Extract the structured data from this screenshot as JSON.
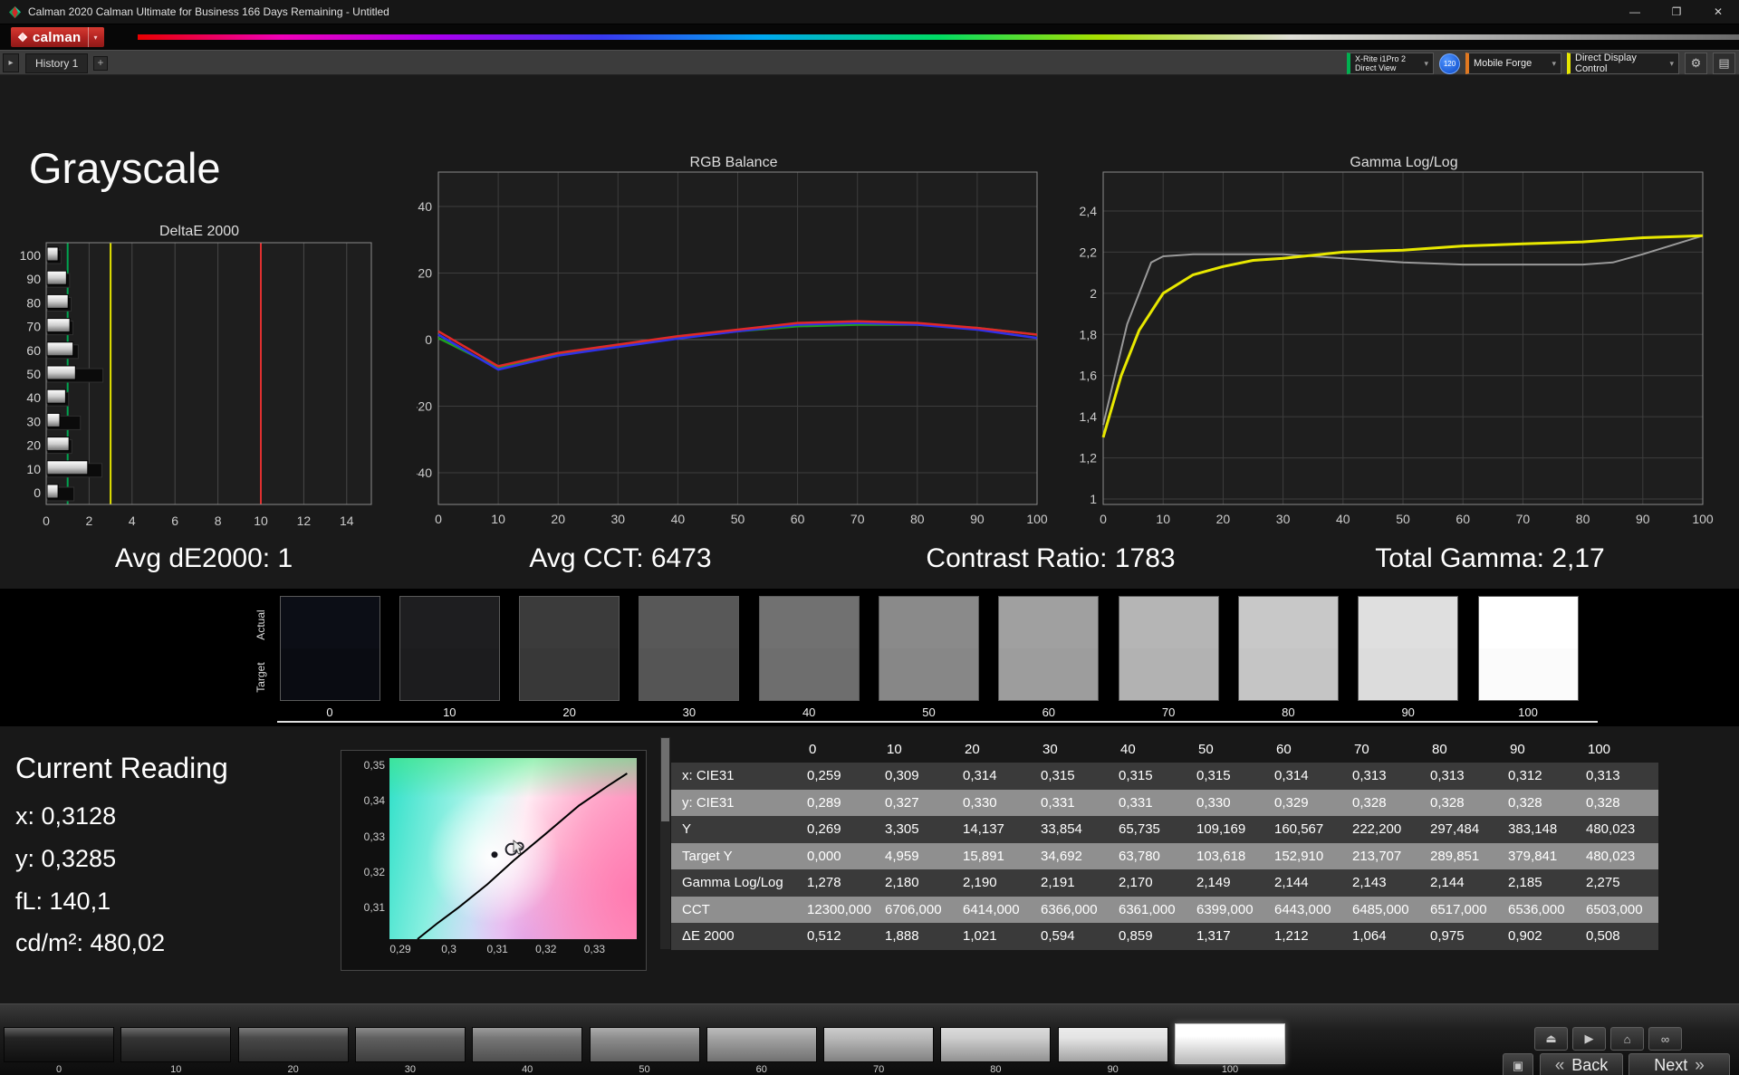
{
  "window": {
    "title": "Calman 2020 Calman Ultimate for Business 166 Days Remaining - Untitled",
    "controls": {
      "minimize": "—",
      "maximize": "❐",
      "close": "✕"
    }
  },
  "brand": {
    "logo": "calman"
  },
  "icons": {
    "caret_down": "▾",
    "caret_right": "▸",
    "plus": "+",
    "gear": "⚙",
    "panel": "▤",
    "eject": "⏏",
    "play": "▶",
    "home": "⌂",
    "link": "∞",
    "grid": "▣",
    "chevrons_left": "«",
    "chevrons_right": "»"
  },
  "toolbar": {
    "history_tab": "History 1",
    "meter": {
      "line1": "X-Rite i1Pro 2",
      "line2": "Direct View"
    },
    "badge": "120",
    "source": "Mobile Forge",
    "display_control": "Direct Display Control"
  },
  "page_title": "Grayscale",
  "stats": {
    "avg_de": "Avg dE2000: 1",
    "avg_cct": "Avg CCT: 6473",
    "contrast": "Contrast Ratio: 1783",
    "gamma": "Total Gamma: 2,17"
  },
  "charts": {
    "deltae": {
      "type": "bar",
      "title": "DeltaE 2000",
      "orientation": "horizontal",
      "categories": [
        "100",
        "90",
        "80",
        "70",
        "60",
        "50",
        "40",
        "30",
        "20",
        "10",
        "0"
      ],
      "values": [
        0.51,
        0.9,
        0.98,
        1.06,
        1.21,
        1.32,
        0.86,
        0.59,
        1.02,
        1.89,
        0.51
      ],
      "shadow_values": [
        0.65,
        1.05,
        1.12,
        1.2,
        1.45,
        2.6,
        1.0,
        1.55,
        1.15,
        2.55,
        1.25
      ],
      "x_ticks": [
        0,
        2,
        4,
        6,
        8,
        10,
        12,
        14
      ],
      "xlim": [
        0,
        15.1
      ],
      "reference_lines": [
        {
          "value": 1,
          "color": "#00a550"
        },
        {
          "value": 3,
          "color": "#e3e300"
        },
        {
          "value": 10,
          "color": "#e03030"
        }
      ]
    },
    "rgb_balance": {
      "type": "line",
      "title": "RGB Balance",
      "x_ticks": [
        0,
        10,
        20,
        30,
        40,
        50,
        60,
        70,
        80,
        90,
        100
      ],
      "y_ticks": [
        40,
        20,
        0,
        -20,
        -40
      ],
      "ylim": [
        -50,
        50
      ],
      "series": [
        {
          "name": "Green",
          "color": "#1fa01f",
          "values": [
            0.5,
            -8.5,
            -4.5,
            -2,
            0.5,
            2.5,
            4,
            4.5,
            4.5,
            3.5,
            1.5
          ]
        },
        {
          "name": "Blue",
          "color": "#3030e8",
          "values": [
            1.5,
            -9,
            -4.8,
            -2.2,
            0.3,
            2.5,
            4.5,
            5,
            4.5,
            3,
            0.5
          ]
        },
        {
          "name": "Red",
          "color": "#e02828",
          "values": [
            2.5,
            -8,
            -4,
            -1.5,
            1,
            3,
            5,
            5.5,
            5,
            3.5,
            1.5
          ]
        }
      ]
    },
    "gamma": {
      "type": "line",
      "title": "Gamma Log/Log",
      "x_ticks": [
        0,
        10,
        20,
        30,
        40,
        50,
        60,
        70,
        80,
        90,
        100
      ],
      "y_ticks": [
        2.4,
        2.2,
        2.0,
        1.8,
        1.6,
        1.4,
        1.2,
        1.0
      ],
      "y_tick_labels": [
        "2,4",
        "2,2",
        "2",
        "1,8",
        "1,6",
        "1,4",
        "1,2",
        "1"
      ],
      "ylim": [
        0.97,
        2.49
      ],
      "series": [
        {
          "name": "Measured",
          "color": "#9a9a9a",
          "x": [
            0,
            4,
            8,
            10,
            15,
            20,
            30,
            40,
            50,
            60,
            70,
            80,
            85,
            90,
            100
          ],
          "values": [
            1.36,
            1.85,
            2.15,
            2.18,
            2.19,
            2.19,
            2.19,
            2.17,
            2.15,
            2.14,
            2.14,
            2.14,
            2.15,
            2.19,
            2.28
          ]
        },
        {
          "name": "Target",
          "color": "#e8e800",
          "x": [
            0,
            3,
            6,
            10,
            15,
            20,
            25,
            30,
            40,
            50,
            60,
            70,
            80,
            90,
            100
          ],
          "values": [
            1.3,
            1.6,
            1.82,
            2.0,
            2.09,
            2.13,
            2.16,
            2.17,
            2.2,
            2.21,
            2.23,
            2.24,
            2.25,
            2.27,
            2.28
          ]
        }
      ]
    }
  },
  "swatch_strip": {
    "row_labels": [
      "Actual",
      "Target"
    ],
    "levels": [
      "0",
      "10",
      "20",
      "30",
      "40",
      "50",
      "60",
      "70",
      "80",
      "90",
      "100"
    ],
    "actual_colors": [
      "#0c0e16",
      "#1e1e20",
      "#3b3b3b",
      "#585858",
      "#717171",
      "#8a8a8a",
      "#a0a0a0",
      "#b5b5b5",
      "#c8c8c8",
      "#dfdfdf",
      "#ffffff"
    ],
    "target_colors": [
      "#0a0c12",
      "#1c1c1e",
      "#383838",
      "#555555",
      "#6e6e6e",
      "#878787",
      "#9d9d9d",
      "#b2b2b2",
      "#c5c5c5",
      "#dcdcdc",
      "#fbfbfb"
    ]
  },
  "current_reading": {
    "title": "Current Reading",
    "lines": [
      "x: 0,3128",
      "y: 0,3285",
      "fL: 140,1",
      "cd/m²: 480,02"
    ]
  },
  "cie": {
    "y_tick_labels": [
      "0,35",
      "0,34",
      "0,33",
      "0,32",
      "0,31"
    ],
    "x_tick_labels": [
      "0,29",
      "0,3",
      "0,31",
      "0,32",
      "0,33"
    ],
    "x_range": [
      0.2877,
      0.339
    ],
    "y_range": [
      0.3017,
      0.3523
    ],
    "locus": [
      [
        0.2935,
        0.3017
      ],
      [
        0.2975,
        0.306
      ],
      [
        0.302,
        0.3105
      ],
      [
        0.308,
        0.317
      ],
      [
        0.3135,
        0.3237
      ],
      [
        0.32,
        0.331
      ],
      [
        0.327,
        0.339
      ],
      [
        0.333,
        0.3445
      ],
      [
        0.337,
        0.348
      ]
    ],
    "points": [
      {
        "x": 0.3095,
        "y": 0.3253,
        "r": 3.5,
        "type": "dot"
      },
      {
        "x": 0.313,
        "y": 0.3268,
        "r": 6,
        "type": "circle"
      },
      {
        "x": 0.3147,
        "y": 0.3276,
        "r": 4,
        "type": "circle"
      }
    ]
  },
  "table": {
    "col_headers": [
      "0",
      "10",
      "20",
      "30",
      "40",
      "50",
      "60",
      "70",
      "80",
      "90",
      "100"
    ],
    "rows": [
      {
        "label": "x: CIE31",
        "values": [
          "0,259",
          "0,309",
          "0,314",
          "0,315",
          "0,315",
          "0,315",
          "0,314",
          "0,313",
          "0,313",
          "0,312",
          "0,313"
        ]
      },
      {
        "label": "y: CIE31",
        "values": [
          "0,289",
          "0,327",
          "0,330",
          "0,331",
          "0,331",
          "0,330",
          "0,329",
          "0,328",
          "0,328",
          "0,328",
          "0,328"
        ]
      },
      {
        "label": "Y",
        "values": [
          "0,269",
          "3,305",
          "14,137",
          "33,854",
          "65,735",
          "109,169",
          "160,567",
          "222,200",
          "297,484",
          "383,148",
          "480,023"
        ]
      },
      {
        "label": "Target Y",
        "values": [
          "0,000",
          "4,959",
          "15,891",
          "34,692",
          "63,780",
          "103,618",
          "152,910",
          "213,707",
          "289,851",
          "379,841",
          "480,023"
        ]
      },
      {
        "label": "Gamma Log/Log",
        "values": [
          "1,278",
          "2,180",
          "2,190",
          "2,191",
          "2,170",
          "2,149",
          "2,144",
          "2,143",
          "2,144",
          "2,185",
          "2,275"
        ]
      },
      {
        "label": "CCT",
        "values": [
          "12300,000",
          "6706,000",
          "6414,000",
          "6366,000",
          "6361,000",
          "6399,000",
          "6443,000",
          "6485,000",
          "6517,000",
          "6536,000",
          "6503,000"
        ]
      },
      {
        "label": "ΔE 2000",
        "values": [
          "0,512",
          "1,888",
          "1,021",
          "0,594",
          "0,859",
          "1,317",
          "1,212",
          "1,064",
          "0,975",
          "0,902",
          "0,508"
        ]
      }
    ]
  },
  "bottom_bar": {
    "levels": [
      "0",
      "10",
      "20",
      "30",
      "40",
      "50",
      "60",
      "70",
      "80",
      "90",
      "100"
    ],
    "colors": [
      "#161616",
      "#282828",
      "#3e3e3e",
      "#565656",
      "#6e6e6e",
      "#868686",
      "#9d9d9d",
      "#b4b4b4",
      "#cacaca",
      "#e2e2e2",
      "#ffffff"
    ],
    "selected_index": 10,
    "back": "Back",
    "next": "Next"
  }
}
